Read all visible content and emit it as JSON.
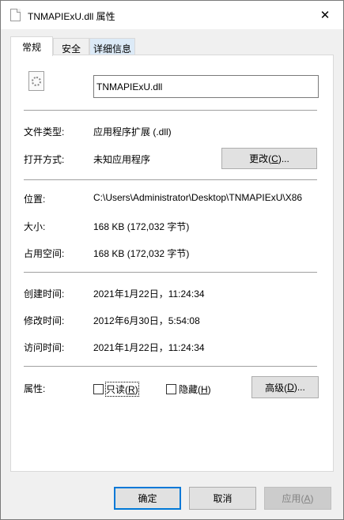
{
  "window": {
    "title": "TNMAPIExU.dll 属性"
  },
  "tabs": {
    "general": "常规",
    "security": "安全",
    "details": "详细信息"
  },
  "file": {
    "name": "TNMAPIExU.dll"
  },
  "info": {
    "type_label": "文件类型:",
    "type_value": "应用程序扩展 (.dll)",
    "opens_label": "打开方式:",
    "opens_value": "未知应用程序",
    "change_button": "更改(C)...",
    "change_prefix": "更改(",
    "change_key": "C",
    "change_suffix": ")...",
    "location_label": "位置:",
    "location_value": "C:\\Users\\Administrator\\Desktop\\TNMAPIExU\\X86",
    "size_label": "大小:",
    "size_value": "168 KB (172,032 字节)",
    "disk_label": "占用空间:",
    "disk_value": "168 KB (172,032 字节)",
    "created_label": "创建时间:",
    "created_value": "2021年1月22日，11:24:34",
    "modified_label": "修改时间:",
    "modified_value": "2012年6月30日，5:54:08",
    "accessed_label": "访问时间:",
    "accessed_value": "2021年1月22日，11:24:34",
    "attributes_label": "属性:"
  },
  "attributes": {
    "readonly_prefix": "只读(",
    "readonly_key": "R",
    "readonly_suffix": ")",
    "readonly_checked": false,
    "hidden_prefix": "隐藏(",
    "hidden_key": "H",
    "hidden_suffix": ")",
    "hidden_checked": false,
    "advanced_prefix": "高级(",
    "advanced_key": "D",
    "advanced_suffix": ")..."
  },
  "footer": {
    "ok": "确定",
    "cancel": "取消",
    "apply_prefix": "应用(",
    "apply_key": "A",
    "apply_suffix": ")"
  },
  "icons": {
    "title": "dll-file-icon",
    "close": "close-icon",
    "file": "dll-file-gear-icon"
  }
}
